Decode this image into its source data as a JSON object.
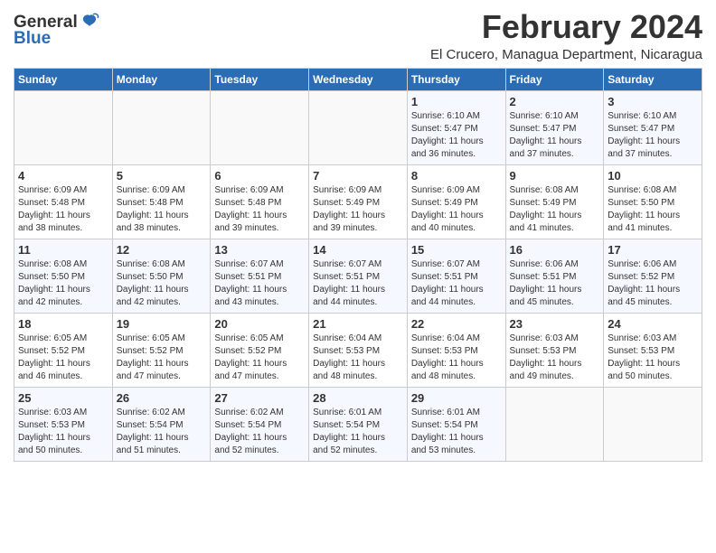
{
  "header": {
    "logo_general": "General",
    "logo_blue": "Blue",
    "month_title": "February 2024",
    "location": "El Crucero, Managua Department, Nicaragua"
  },
  "days_of_week": [
    "Sunday",
    "Monday",
    "Tuesday",
    "Wednesday",
    "Thursday",
    "Friday",
    "Saturday"
  ],
  "weeks": [
    [
      {
        "day": "",
        "info": ""
      },
      {
        "day": "",
        "info": ""
      },
      {
        "day": "",
        "info": ""
      },
      {
        "day": "",
        "info": ""
      },
      {
        "day": "1",
        "info": "Sunrise: 6:10 AM\nSunset: 5:47 PM\nDaylight: 11 hours\nand 36 minutes."
      },
      {
        "day": "2",
        "info": "Sunrise: 6:10 AM\nSunset: 5:47 PM\nDaylight: 11 hours\nand 37 minutes."
      },
      {
        "day": "3",
        "info": "Sunrise: 6:10 AM\nSunset: 5:47 PM\nDaylight: 11 hours\nand 37 minutes."
      }
    ],
    [
      {
        "day": "4",
        "info": "Sunrise: 6:09 AM\nSunset: 5:48 PM\nDaylight: 11 hours\nand 38 minutes."
      },
      {
        "day": "5",
        "info": "Sunrise: 6:09 AM\nSunset: 5:48 PM\nDaylight: 11 hours\nand 38 minutes."
      },
      {
        "day": "6",
        "info": "Sunrise: 6:09 AM\nSunset: 5:48 PM\nDaylight: 11 hours\nand 39 minutes."
      },
      {
        "day": "7",
        "info": "Sunrise: 6:09 AM\nSunset: 5:49 PM\nDaylight: 11 hours\nand 39 minutes."
      },
      {
        "day": "8",
        "info": "Sunrise: 6:09 AM\nSunset: 5:49 PM\nDaylight: 11 hours\nand 40 minutes."
      },
      {
        "day": "9",
        "info": "Sunrise: 6:08 AM\nSunset: 5:49 PM\nDaylight: 11 hours\nand 41 minutes."
      },
      {
        "day": "10",
        "info": "Sunrise: 6:08 AM\nSunset: 5:50 PM\nDaylight: 11 hours\nand 41 minutes."
      }
    ],
    [
      {
        "day": "11",
        "info": "Sunrise: 6:08 AM\nSunset: 5:50 PM\nDaylight: 11 hours\nand 42 minutes."
      },
      {
        "day": "12",
        "info": "Sunrise: 6:08 AM\nSunset: 5:50 PM\nDaylight: 11 hours\nand 42 minutes."
      },
      {
        "day": "13",
        "info": "Sunrise: 6:07 AM\nSunset: 5:51 PM\nDaylight: 11 hours\nand 43 minutes."
      },
      {
        "day": "14",
        "info": "Sunrise: 6:07 AM\nSunset: 5:51 PM\nDaylight: 11 hours\nand 44 minutes."
      },
      {
        "day": "15",
        "info": "Sunrise: 6:07 AM\nSunset: 5:51 PM\nDaylight: 11 hours\nand 44 minutes."
      },
      {
        "day": "16",
        "info": "Sunrise: 6:06 AM\nSunset: 5:51 PM\nDaylight: 11 hours\nand 45 minutes."
      },
      {
        "day": "17",
        "info": "Sunrise: 6:06 AM\nSunset: 5:52 PM\nDaylight: 11 hours\nand 45 minutes."
      }
    ],
    [
      {
        "day": "18",
        "info": "Sunrise: 6:05 AM\nSunset: 5:52 PM\nDaylight: 11 hours\nand 46 minutes."
      },
      {
        "day": "19",
        "info": "Sunrise: 6:05 AM\nSunset: 5:52 PM\nDaylight: 11 hours\nand 47 minutes."
      },
      {
        "day": "20",
        "info": "Sunrise: 6:05 AM\nSunset: 5:52 PM\nDaylight: 11 hours\nand 47 minutes."
      },
      {
        "day": "21",
        "info": "Sunrise: 6:04 AM\nSunset: 5:53 PM\nDaylight: 11 hours\nand 48 minutes."
      },
      {
        "day": "22",
        "info": "Sunrise: 6:04 AM\nSunset: 5:53 PM\nDaylight: 11 hours\nand 48 minutes."
      },
      {
        "day": "23",
        "info": "Sunrise: 6:03 AM\nSunset: 5:53 PM\nDaylight: 11 hours\nand 49 minutes."
      },
      {
        "day": "24",
        "info": "Sunrise: 6:03 AM\nSunset: 5:53 PM\nDaylight: 11 hours\nand 50 minutes."
      }
    ],
    [
      {
        "day": "25",
        "info": "Sunrise: 6:03 AM\nSunset: 5:53 PM\nDaylight: 11 hours\nand 50 minutes."
      },
      {
        "day": "26",
        "info": "Sunrise: 6:02 AM\nSunset: 5:54 PM\nDaylight: 11 hours\nand 51 minutes."
      },
      {
        "day": "27",
        "info": "Sunrise: 6:02 AM\nSunset: 5:54 PM\nDaylight: 11 hours\nand 52 minutes."
      },
      {
        "day": "28",
        "info": "Sunrise: 6:01 AM\nSunset: 5:54 PM\nDaylight: 11 hours\nand 52 minutes."
      },
      {
        "day": "29",
        "info": "Sunrise: 6:01 AM\nSunset: 5:54 PM\nDaylight: 11 hours\nand 53 minutes."
      },
      {
        "day": "",
        "info": ""
      },
      {
        "day": "",
        "info": ""
      }
    ]
  ]
}
